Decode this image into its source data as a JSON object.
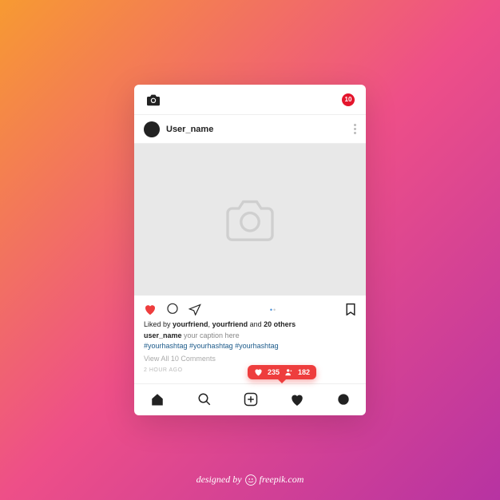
{
  "topbar": {
    "badge_count": "10"
  },
  "user": {
    "name": "User_name"
  },
  "likes": {
    "prefix": "Liked by ",
    "friend1": "yourfriend",
    "sep": ", ",
    "friend2": "yourfriend",
    "and": " and ",
    "others": "20 others"
  },
  "caption": {
    "username": "user_name",
    "text": " your caption here"
  },
  "hashtags": "#yourhashtag #yourhashtag #yourhashtag",
  "comments": {
    "viewall": "View All 10 Comments"
  },
  "time": "2 hour ago",
  "notif": {
    "likes": "235",
    "followers": "182"
  },
  "attribution": {
    "prefix": "designed by ",
    "brand": "freepik.com"
  }
}
